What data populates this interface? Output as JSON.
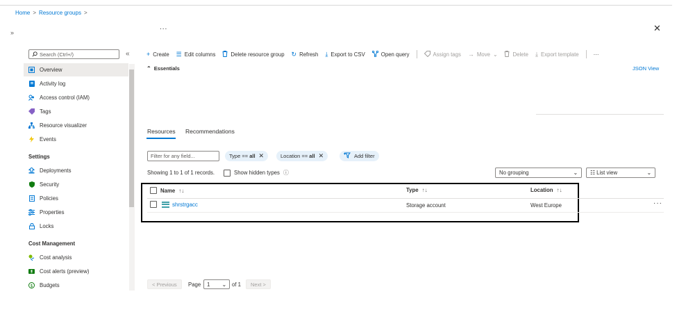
{
  "breadcrumb": {
    "home": "Home",
    "groups": "Resource groups",
    "sep": ">"
  },
  "header": {
    "expand_icon": "»",
    "title_dots": "...",
    "close": "✕"
  },
  "sidebar": {
    "search_placeholder": "Search (Ctrl+/)",
    "collapse": "«",
    "items": [
      {
        "label": "Overview",
        "icon": "overview-icon"
      },
      {
        "label": "Activity log",
        "icon": "activity-log-icon"
      },
      {
        "label": "Access control (IAM)",
        "icon": "people-icon"
      },
      {
        "label": "Tags",
        "icon": "tag-icon"
      },
      {
        "label": "Resource visualizer",
        "icon": "hierarchy-icon"
      },
      {
        "label": "Events",
        "icon": "lightning-icon"
      }
    ],
    "settings_title": "Settings",
    "settings_items": [
      {
        "label": "Deployments",
        "icon": "deploy-icon"
      },
      {
        "label": "Security",
        "icon": "shield-icon"
      },
      {
        "label": "Policies",
        "icon": "policy-icon"
      },
      {
        "label": "Properties",
        "icon": "properties-icon"
      },
      {
        "label": "Locks",
        "icon": "lock-icon"
      }
    ],
    "cost_title": "Cost Management",
    "cost_items": [
      {
        "label": "Cost analysis",
        "icon": "cost-analysis-icon"
      },
      {
        "label": "Cost alerts (preview)",
        "icon": "cost-alert-icon"
      },
      {
        "label": "Budgets",
        "icon": "budget-icon"
      }
    ]
  },
  "toolbar": {
    "create": "Create",
    "edit_columns": "Edit columns",
    "delete_group": "Delete resource group",
    "refresh": "Refresh",
    "export_csv": "Export to CSV",
    "open_query": "Open query",
    "assign_tags": "Assign tags",
    "move": "Move",
    "delete": "Delete",
    "export_template": "Export template",
    "more": "···"
  },
  "essentials": {
    "label": "Essentials",
    "json_view": "JSON View"
  },
  "tabs": {
    "resources": "Resources",
    "recommendations": "Recommendations"
  },
  "filters": {
    "field_placeholder": "Filter for any field...",
    "type_label": "Type == ",
    "type_value": "all",
    "location_label": "Location == ",
    "location_value": "all",
    "add_filter": "Add filter"
  },
  "records": {
    "showing": "Showing 1 to 1 of 1 records.",
    "show_hidden": "Show hidden types",
    "grouping": "No grouping",
    "view": "List view"
  },
  "table": {
    "columns": {
      "name": "Name",
      "type": "Type",
      "location": "Location"
    },
    "rows": [
      {
        "name": "shrstrgacc",
        "type": "Storage account",
        "location": "West Europe"
      }
    ],
    "row_more": "···"
  },
  "pagination": {
    "previous": "< Previous",
    "page": "Page",
    "page_value": "1",
    "of": "of 1",
    "next": "Next >"
  },
  "colors": {
    "accent": "#0078d4",
    "highlight_box": "#000000"
  }
}
